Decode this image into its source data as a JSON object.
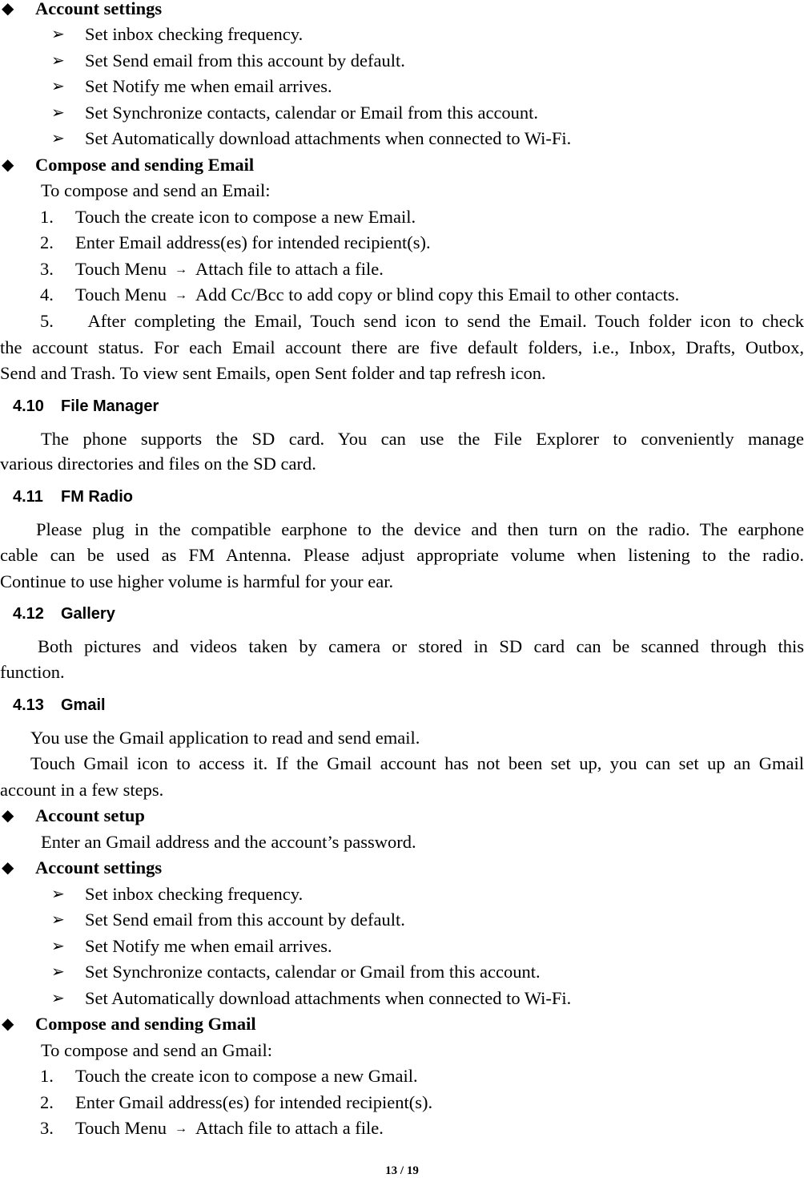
{
  "email_section": {
    "account_settings": {
      "title": "Account settings",
      "items": [
        "Set inbox checking frequency.",
        "Set Send email from this account by default.",
        "Set Notify me when email arrives.",
        "Set Synchronize contacts, calendar or Email from this account.",
        "Set Automatically download attachments when connected to Wi-Fi."
      ]
    },
    "compose": {
      "title": "Compose and sending Email",
      "intro": "To compose and send an Email:",
      "steps": [
        {
          "num": "1.",
          "text": "Touch the create icon to compose a new Email."
        },
        {
          "num": "2.",
          "text": "Enter Email address(es) for intended recipient(s)."
        },
        {
          "num": "3.",
          "pre": "Touch Menu",
          "arrow": "→",
          "post": "Attach file to attach a file."
        },
        {
          "num": "4.",
          "pre": "Touch Menu",
          "arrow": "→",
          "post": "Add Cc/Bcc to add copy or blind copy this Email to other contacts."
        },
        {
          "num": "5.",
          "line1": "After completing the Email, Touch send icon to send the Email. Touch folder icon to check",
          "line2": "the account status. For each Email account there are five default folders, i.e., Inbox, Drafts, Outbox,",
          "line3": "Send and Trash. To view sent Emails, open Sent folder and tap refresh icon."
        }
      ]
    }
  },
  "file_manager": {
    "number": "4.10",
    "title": "File Manager",
    "line1": "The phone supports the SD card. You can use the File Explorer to conveniently manage",
    "line2": "various directories and files on the SD card."
  },
  "fm_radio": {
    "number": "4.11",
    "title": "FM Radio",
    "line1": "Please plug in the compatible earphone to the device and then turn on the radio. The earphone",
    "line2": "cable can be used as FM Antenna. Please adjust appropriate volume when listening to the radio.",
    "line3": "Continue to use higher volume is harmful for your ear."
  },
  "gallery": {
    "number": "4.12",
    "title": "Gallery",
    "line1": "Both pictures and videos taken by camera or stored in SD card can be scanned through this",
    "line2": "function."
  },
  "gmail": {
    "number": "4.13",
    "title": "Gmail",
    "para1": "You use the Gmail application to read and send email.",
    "para2_line1": "Touch Gmail icon to access it. If the Gmail account has not been set up, you can set up an Gmail",
    "para2_line2": "account in a few steps.",
    "account_setup": {
      "title": "Account setup",
      "text": "Enter an Gmail address and the account’s password."
    },
    "account_settings": {
      "title": "Account settings",
      "items": [
        "Set inbox checking frequency.",
        "Set Send email from this account by default.",
        "Set Notify me when email arrives.",
        "Set Synchronize contacts, calendar or Gmail from this account.",
        "Set Automatically download attachments when connected to Wi-Fi."
      ]
    },
    "compose": {
      "title": "Compose and sending Gmail",
      "intro": "To compose and send an Gmail:",
      "steps": [
        {
          "num": "1.",
          "text": "Touch the create icon to compose a new Gmail."
        },
        {
          "num": "2.",
          "text": "Enter Gmail address(es) for intended recipient(s)."
        },
        {
          "num": "3.",
          "pre": "Touch Menu",
          "arrow": "→",
          "post": "Attach file to attach a file."
        }
      ]
    }
  },
  "icons": {
    "diamond": "◆",
    "arrow_bullet": "➢"
  },
  "footer": {
    "page": "13 / 19"
  }
}
